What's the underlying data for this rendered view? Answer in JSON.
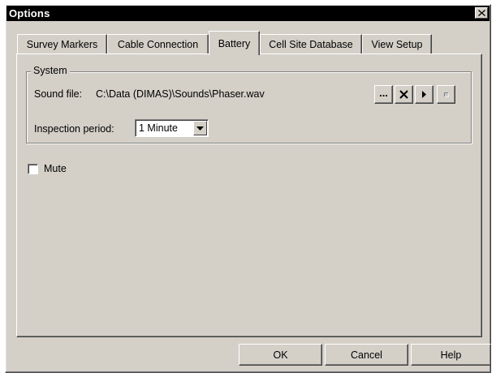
{
  "window": {
    "title": "Options"
  },
  "tabs": [
    {
      "label": "Survey Markers",
      "active": false
    },
    {
      "label": "Cable Connection",
      "active": false
    },
    {
      "label": "Battery",
      "active": true
    },
    {
      "label": "Cell Site Database",
      "active": false
    },
    {
      "label": "View Setup",
      "active": false
    }
  ],
  "system_group": {
    "label": "System",
    "sound_file_label": "Sound file:",
    "sound_file_path": "C:\\Data (DIMAS)\\Sounds\\Phaser.wav",
    "buttons": {
      "browse": "...",
      "clear_icon": "x-icon",
      "play_icon": "play-icon",
      "stop_icon": "stop-icon"
    },
    "inspection_label": "Inspection period:",
    "inspection_value": "1 Minute"
  },
  "mute": {
    "label": "Mute",
    "checked": false
  },
  "footer": {
    "ok": "OK",
    "cancel": "Cancel",
    "help": "Help"
  },
  "colors": {
    "face": "#d4d0c8",
    "titlebar": "#000000",
    "title_text": "#ffffff"
  }
}
